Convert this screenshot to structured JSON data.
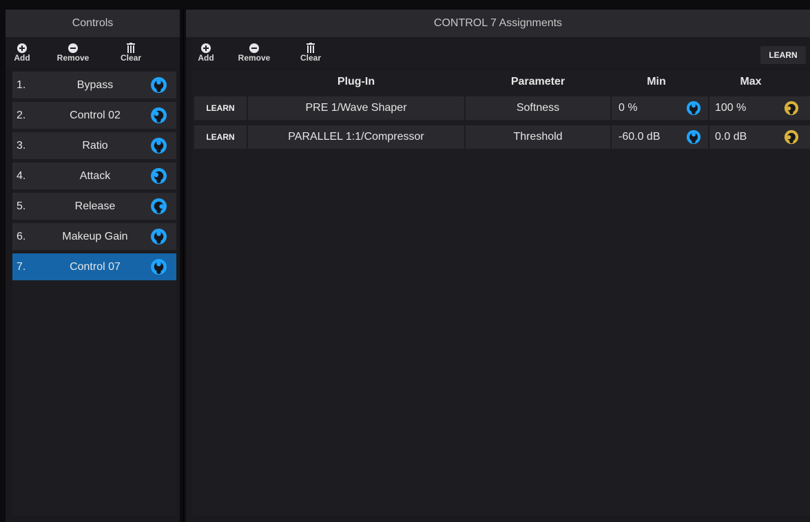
{
  "colors": {
    "accent_blue": "#1fa4ff",
    "accent_gold": "#d8b23a",
    "selection": "#1565a8"
  },
  "left_panel": {
    "title": "Controls",
    "toolbar": {
      "add": "Add",
      "remove": "Remove",
      "clear": "Clear"
    },
    "controls": [
      {
        "num": "1.",
        "name": "Bypass",
        "knob_level": 0.5
      },
      {
        "num": "2.",
        "name": "Control 02",
        "knob_level": 0.3
      },
      {
        "num": "3.",
        "name": "Ratio",
        "knob_level": 0.5
      },
      {
        "num": "4.",
        "name": "Attack",
        "knob_level": 0.25
      },
      {
        "num": "5.",
        "name": "Release",
        "knob_level": 0.85
      },
      {
        "num": "6.",
        "name": "Makeup Gain",
        "knob_level": 0.5
      },
      {
        "num": "7.",
        "name": "Control 07",
        "knob_level": 0.5,
        "selected": true
      }
    ]
  },
  "right_panel": {
    "title": "CONTROL 7 Assignments",
    "toolbar": {
      "add": "Add",
      "remove": "Remove",
      "clear": "Clear",
      "learn": "LEARN"
    },
    "columns": {
      "plugin": "Plug-In",
      "parameter": "Parameter",
      "min": "Min",
      "max": "Max"
    },
    "rows": [
      {
        "learn": "LEARN",
        "plugin": "PRE 1/Wave Shaper",
        "parameter": "Softness",
        "min": "0 %",
        "max": "100 %"
      },
      {
        "learn": "LEARN",
        "plugin": "PARALLEL 1:1/Compressor",
        "parameter": "Threshold",
        "min": "-60.0 dB",
        "max": "0.0 dB"
      }
    ]
  }
}
